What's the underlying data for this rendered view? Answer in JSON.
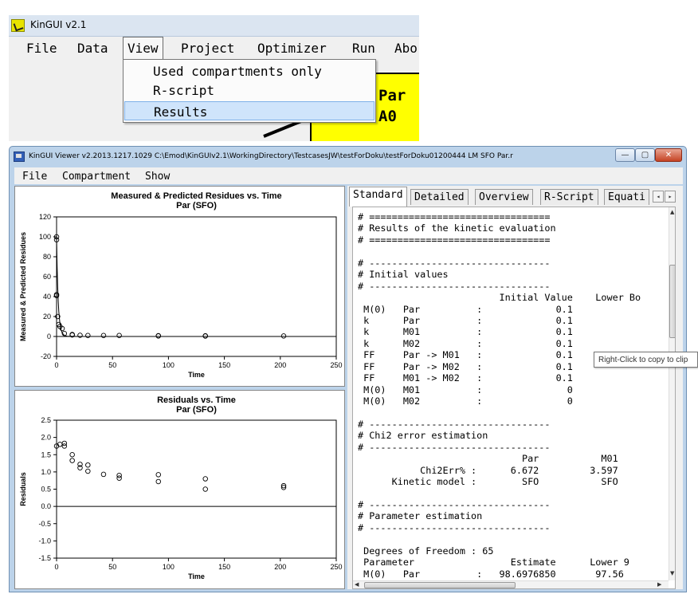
{
  "top_window": {
    "title": "KinGUI v2.1",
    "menu": [
      "File",
      "Data",
      "View",
      "Project",
      "Optimizer",
      "Run",
      "Abo"
    ],
    "active_menu": "View",
    "dropdown": [
      "Used compartments only",
      "R-script",
      "Results"
    ],
    "highlighted_item": "Results",
    "yellow_box_lines": [
      "Par",
      "A0"
    ]
  },
  "viewer": {
    "title": "KinGUI Viewer v2.2013.1217.1029   C:\\Emod\\KinGUIv2.1\\WorkingDirectory\\TestcasesJW\\testForDoku\\testForDoku01200444 LM SFO  Par.r",
    "window_buttons": {
      "minimize": "—",
      "maximize": "▢",
      "close": "✕"
    },
    "menu": [
      "File",
      "Compartment",
      "Show"
    ],
    "tabs": [
      "Standard",
      "Detailed",
      "Overview",
      "R-Script",
      "Equati"
    ],
    "active_tab": "Standard",
    "tooltip": "Right-Click to copy to clip",
    "results_lines": [
      "# ================================",
      "# Results of the kinetic evaluation",
      "# ================================",
      "",
      "# --------------------------------",
      "# Initial values",
      "# --------------------------------",
      "                         Initial Value    Lower Bo",
      " M(0)   Par          :             0.1",
      " k      Par          :             0.1",
      " k      M01          :             0.1",
      " k      M02          :             0.1",
      " FF     Par -> M01   :             0.1",
      " FF     Par -> M02   :             0.1",
      " FF     M01 -> M02   :             0.1",
      " M(0)   M01          :               0",
      " M(0)   M02          :               0",
      "",
      "# --------------------------------",
      "# Chi2 error estimation",
      "# --------------------------------",
      "                             Par           M01",
      "           Chi2Err% :      6.672         3.597",
      "      Kinetic model :        SFO           SFO",
      "",
      "# --------------------------------",
      "# Parameter estimation",
      "# --------------------------------",
      "",
      " Degrees of Freedom : 65",
      " Parameter                 Estimate      Lower 9",
      " M(0)   Par          :   98.6976850       97.56"
    ]
  },
  "chart_data": [
    {
      "type": "scatter",
      "title": "Measured & Predicted Residues vs. Time",
      "subtitle": "Par (SFO)",
      "xlabel": "Time",
      "ylabel": "Measured & Predicted Residues",
      "xlim": [
        0,
        250
      ],
      "ylim": [
        -20,
        120
      ],
      "xticks": [
        0,
        50,
        100,
        150,
        200,
        250
      ],
      "yticks": [
        -20,
        0,
        20,
        40,
        60,
        80,
        100,
        120
      ],
      "points": [
        [
          0,
          100
        ],
        [
          0,
          97
        ],
        [
          0,
          42
        ],
        [
          0,
          41
        ],
        [
          1,
          20
        ],
        [
          2,
          12
        ],
        [
          3,
          10
        ],
        [
          5,
          8
        ],
        [
          7,
          3
        ],
        [
          14,
          2
        ],
        [
          14,
          1.5
        ],
        [
          21,
          1.2
        ],
        [
          28,
          1
        ],
        [
          42,
          1
        ],
        [
          56,
          1
        ],
        [
          91,
          0.8
        ],
        [
          91,
          0.5
        ],
        [
          133,
          0.7
        ],
        [
          133,
          0.4
        ],
        [
          203,
          0.5
        ]
      ],
      "fitted_line": [
        [
          0,
          98.7
        ],
        [
          0.5,
          70
        ],
        [
          1,
          50
        ],
        [
          1.5,
          35
        ],
        [
          2,
          25
        ],
        [
          3,
          13
        ],
        [
          4,
          7
        ],
        [
          5,
          3.6
        ],
        [
          7,
          1
        ],
        [
          10,
          0.2
        ],
        [
          20,
          0
        ],
        [
          250,
          0
        ]
      ],
      "hline": 0
    },
    {
      "type": "scatter",
      "title": "Residuals vs. Time",
      "subtitle": "Par (SFO)",
      "xlabel": "Time",
      "ylabel": "Residuals",
      "xlim": [
        0,
        250
      ],
      "ylim": [
        -1.5,
        2.5
      ],
      "xticks": [
        0,
        50,
        100,
        150,
        200,
        250
      ],
      "yticks": [
        -1.5,
        -1.0,
        -0.5,
        0.0,
        0.5,
        1.0,
        1.5,
        2.0,
        2.5
      ],
      "points": [
        [
          0,
          1.75
        ],
        [
          3,
          1.8
        ],
        [
          7,
          1.83
        ],
        [
          7,
          1.75
        ],
        [
          14,
          1.5
        ],
        [
          14,
          1.33
        ],
        [
          21,
          1.22
        ],
        [
          21,
          1.12
        ],
        [
          28,
          1.2
        ],
        [
          28,
          1.02
        ],
        [
          42,
          0.93
        ],
        [
          56,
          0.9
        ],
        [
          56,
          0.82
        ],
        [
          91,
          0.92
        ],
        [
          91,
          0.72
        ],
        [
          133,
          0.8
        ],
        [
          133,
          0.5
        ],
        [
          203,
          0.6
        ],
        [
          203,
          0.55
        ]
      ],
      "hline": 0
    }
  ]
}
